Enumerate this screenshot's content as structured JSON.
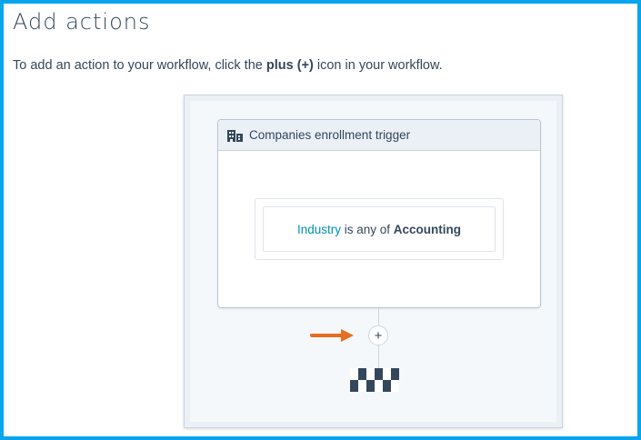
{
  "heading": "Add actions",
  "intro": {
    "before": "To add an action to your workflow, click the ",
    "bold": "plus (+)",
    "after": " icon in your workflow."
  },
  "workflow": {
    "trigger_title": "Companies enrollment trigger",
    "trigger_icon": "company-building-icon",
    "filter": {
      "property": "Industry",
      "operator": " is any of ",
      "value": "Accounting"
    },
    "plus_label": "+",
    "end_icon": "checkered-flag-icon"
  },
  "colors": {
    "frame_border": "#06a5ed",
    "link": "#0091ae",
    "arrow": "#e66e22",
    "text": "#33475b"
  }
}
